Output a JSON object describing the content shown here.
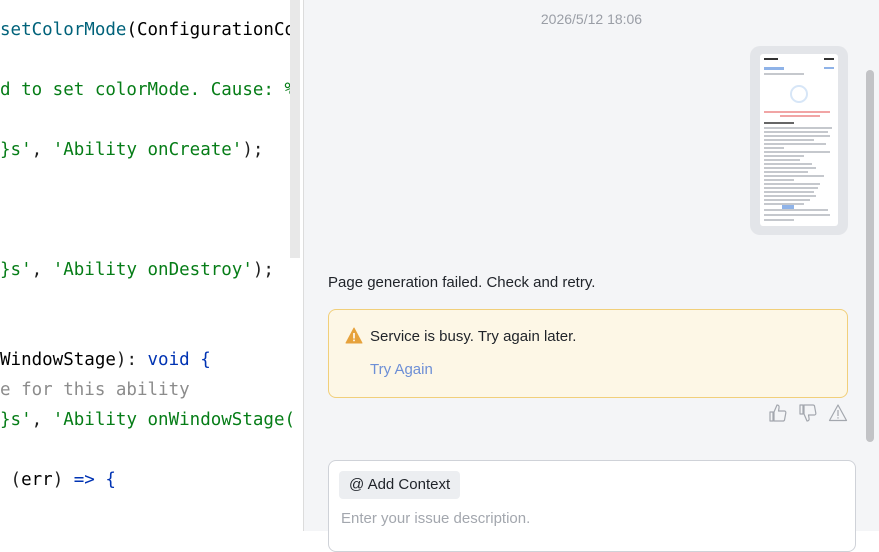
{
  "editor": {
    "lines": [
      {
        "parts": [
          {
            "text": "setColorMode",
            "cls": "c-fn"
          },
          {
            "text": "(ConfigurationCo",
            "cls": "c-type"
          }
        ]
      },
      {
        "parts": [
          {
            "text": "d to set colorMode. Cause: %",
            "cls": "c-str"
          }
        ]
      },
      {
        "parts": [
          {
            "text": "}s'",
            "cls": "c-str"
          },
          {
            "text": ", ",
            "cls": "c-plain"
          },
          {
            "text": "'Ability onCreate'",
            "cls": "c-str"
          },
          {
            "text": ");",
            "cls": "c-plain"
          }
        ]
      },
      {
        "parts": [
          {
            "text": "}s'",
            "cls": "c-str"
          },
          {
            "text": ", ",
            "cls": "c-plain"
          },
          {
            "text": "'Ability onDestroy'",
            "cls": "c-str"
          },
          {
            "text": ");",
            "cls": "c-plain"
          }
        ]
      },
      {
        "parts": [
          {
            "text": "WindowStage",
            "cls": "c-type"
          },
          {
            "text": "): ",
            "cls": "c-plain"
          },
          {
            "text": "void",
            "cls": "c-kw"
          },
          {
            "text": " {",
            "cls": "c-brace"
          }
        ]
      },
      {
        "parts": [
          {
            "text": "e for this ability",
            "cls": "c-comment"
          }
        ]
      },
      {
        "parts": [
          {
            "text": "}s'",
            "cls": "c-str"
          },
          {
            "text": ", ",
            "cls": "c-plain"
          },
          {
            "text": "'Ability onWindowStage(",
            "cls": "c-str"
          }
        ]
      },
      {
        "parts": [
          {
            "text": " (",
            "cls": "c-plain"
          },
          {
            "text": "err",
            "cls": "c-type"
          },
          {
            "text": ") ",
            "cls": "c-plain"
          },
          {
            "text": "=>",
            "cls": "c-arrow"
          },
          {
            "text": " {",
            "cls": "c-brace"
          }
        ]
      }
    ]
  },
  "chat": {
    "timestamp": "2026/5/12 18:06",
    "failure_message": "Page generation failed. Check and retry.",
    "warning": {
      "text": "Service is busy. Try again later.",
      "retry_label": "Try Again"
    },
    "input": {
      "add_context_label": "@ Add Context",
      "placeholder": "Enter your issue description."
    }
  },
  "colors": {
    "warning_bg": "#fdf7e6",
    "warning_border": "#f1cf7a",
    "link": "#6d8fd6"
  }
}
